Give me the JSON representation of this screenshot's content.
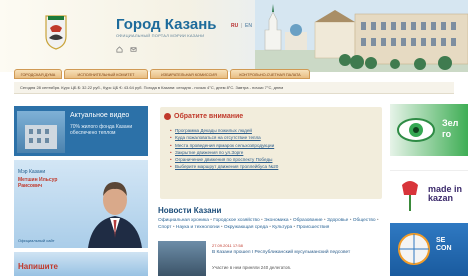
{
  "header": {
    "title": "Город Казань",
    "subtitle": "ОФИЦИАЛЬНЫЙ ПОРТАЛ МЭРИИ КАЗАНИ",
    "languages": [
      {
        "label": "RU",
        "active": true
      },
      {
        "label": "EN",
        "active": false
      },
      {
        "label": "TT",
        "active": false
      }
    ],
    "lang_separator": "|"
  },
  "nav": {
    "tabs": [
      {
        "label": "ГОРОДСКАЯ ДУМА"
      },
      {
        "label": "ИСПОЛНИТЕЛЬНЫЙ КОМИТЕТ"
      },
      {
        "label": "ИЗБИРАТЕЛЬНАЯ КОМИССИЯ"
      },
      {
        "label": "КОНТРОЛЬНО-СЧЕТНАЯ ПАЛАТА"
      }
    ]
  },
  "infobar": {
    "text": "Сегодня 28 сентября. Курс ЦБ $: 32.22 руб., Курс ЦБ €: 43.64 руб. Погода в Казани: сегодня - ночью 4°C, днем 8°C. Завтра - ночью 7°C, днем"
  },
  "video": {
    "title": "Актуальное видео",
    "text": "70% жилого фонда Казани обеспечено теплом"
  },
  "mayor": {
    "title": "Мэр Казани",
    "name": "Метшин Ильсур Раисович",
    "site_link": "Официальный сайт"
  },
  "write": {
    "label": "Напишите"
  },
  "attention": {
    "heading": "Обратите внимание",
    "items": [
      "Программа Декады пожилых людей",
      "Куда пожаловаться на отсутствие тепла",
      "Места проведения ярмарок сельхозпродукции",
      "Закрытие движения по ул.Зорге",
      "Ограничение движения по проспекту Победы",
      "Выберите маршрут движения троллейбуса №20"
    ]
  },
  "news": {
    "title": "Новости Казани",
    "categories": [
      "Официальная хроника",
      "Городское хозяйство",
      "Экономика",
      "Образование",
      "Здоровье",
      "Общество",
      "Спорт",
      "Наука и технологии",
      "Окружающая среда",
      "Культура",
      "Происшествия"
    ],
    "item": {
      "date": "27.09.2011 17:58",
      "headline": "В Казани прошел I Республиканский мусульманский педсовет",
      "snippet": "Участие в нем приняли 240 делегатов."
    }
  },
  "banners": [
    {
      "text": "Зел\nго"
    },
    {
      "text": "made in\nkazan"
    },
    {
      "text": "SE\nCON"
    }
  ],
  "colors": {
    "brand_blue": "#1d6b9b",
    "accent_red": "#c0392b",
    "nav_orange": "#e8be83"
  }
}
